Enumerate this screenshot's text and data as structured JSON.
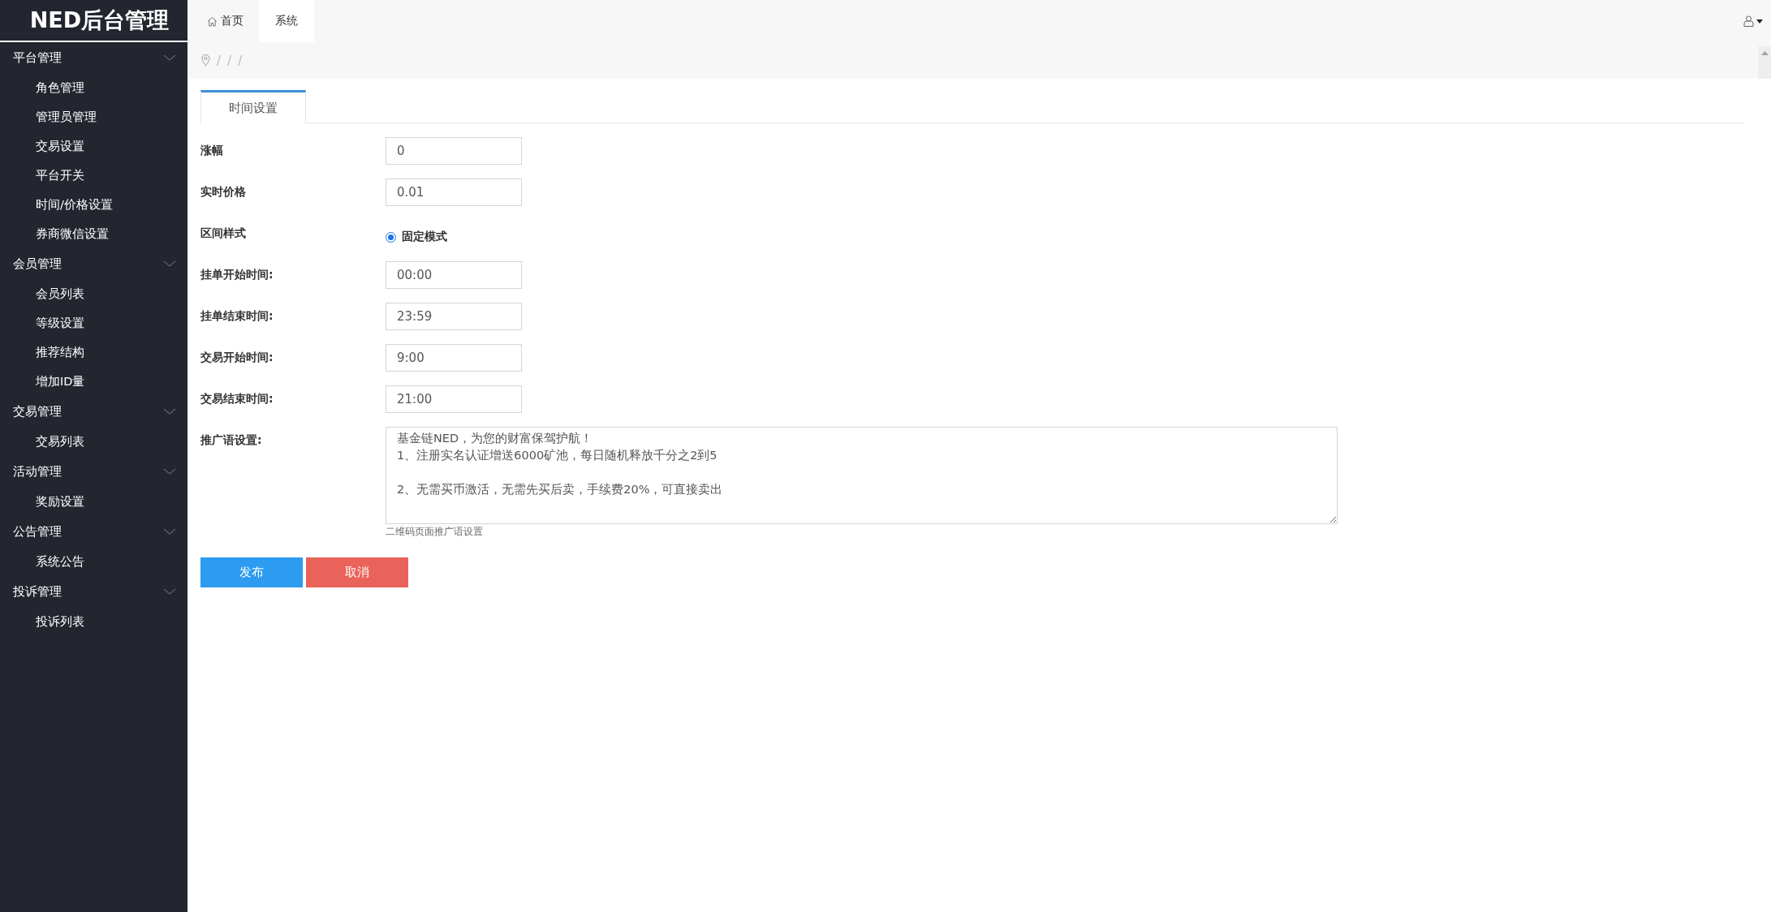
{
  "brand": "NED后台管理",
  "sidebar": {
    "groups": [
      {
        "label": "平台管理",
        "expanded": true,
        "children": [
          {
            "label": "角色管理",
            "selected": false
          },
          {
            "label": "管理员管理",
            "selected": false
          },
          {
            "label": "交易设置",
            "selected": false
          },
          {
            "label": "平台开关",
            "selected": false
          },
          {
            "label": "时间/价格设置",
            "selected": false
          },
          {
            "label": "券商微信设置",
            "selected": false
          }
        ]
      },
      {
        "label": "会员管理",
        "expanded": true,
        "children": [
          {
            "label": "会员列表",
            "selected": false
          },
          {
            "label": "等级设置",
            "selected": false
          },
          {
            "label": "推荐结构",
            "selected": false
          },
          {
            "label": "增加ID量",
            "selected": false
          }
        ]
      },
      {
        "label": "交易管理",
        "expanded": true,
        "children": [
          {
            "label": "交易列表",
            "selected": false
          }
        ]
      },
      {
        "label": "活动管理",
        "expanded": true,
        "children": [
          {
            "label": "奖励设置",
            "selected": false
          }
        ]
      },
      {
        "label": "公告管理",
        "expanded": true,
        "children": [
          {
            "label": "系统公告",
            "selected": false
          }
        ]
      },
      {
        "label": "投诉管理",
        "expanded": true,
        "children": [
          {
            "label": "投诉列表",
            "selected": false
          }
        ]
      }
    ]
  },
  "top_tabs": [
    {
      "label": "首页",
      "kind": "home",
      "selected": false
    },
    {
      "label": "系统",
      "kind": "plain",
      "selected": true
    }
  ],
  "breadcrumb": {
    "separators": [
      "/",
      "/",
      "/"
    ]
  },
  "content_tabs": [
    {
      "label": "时间设置",
      "selected": true
    }
  ],
  "form": {
    "fields": [
      {
        "kind": "text",
        "label": "涨幅",
        "value": "0"
      },
      {
        "kind": "text",
        "label": "实时价格",
        "value": "0.01"
      },
      {
        "kind": "radio",
        "label": "区间样式",
        "options": [
          {
            "label": "固定模式",
            "selected": true
          }
        ]
      },
      {
        "kind": "text",
        "label": "挂单开始时间:",
        "value": "00:00"
      },
      {
        "kind": "text",
        "label": "挂单结束时间:",
        "value": "23:59"
      },
      {
        "kind": "text",
        "label": "交易开始时间:",
        "value": "9:00"
      },
      {
        "kind": "text",
        "label": "交易结束时间:",
        "value": "21:00"
      },
      {
        "kind": "textarea",
        "label": "推广语设置:",
        "value": "基金链NED，为您的财富保驾护航！\n1、注册实名认证增送6000矿池，每日随机释放千分之2到5\n\n2、无需买币激活，无需先买后卖，手续费20%，可直接卖出",
        "hint": "二维码页面推广语设置"
      }
    ],
    "buttons": [
      {
        "label": "发布",
        "kind": "primary"
      },
      {
        "label": "取消",
        "kind": "danger"
      }
    ]
  }
}
